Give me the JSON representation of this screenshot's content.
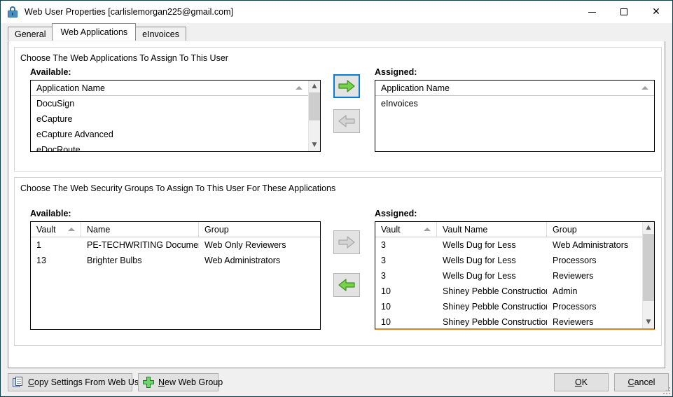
{
  "window": {
    "title": "Web User Properties [carlislemorgan225@gmail.com]",
    "icon": "lock-icon",
    "controls": {
      "minimize": "—",
      "maximize": "☐",
      "close": "✕"
    }
  },
  "tabs": [
    {
      "label": "General",
      "active": false
    },
    {
      "label": "Web Applications",
      "active": true
    },
    {
      "label": "eInvoices",
      "active": false
    }
  ],
  "applications_section": {
    "instruction": "Choose The Web Applications To Assign To This User",
    "available_label": "Available:",
    "assigned_label": "Assigned:",
    "available_list": {
      "column_header": "Application Name",
      "sort_indicator": "ascending",
      "items": [
        "DocuSign",
        "eCapture",
        "eCapture Advanced",
        "eDocRoute"
      ]
    },
    "assigned_list": {
      "column_header": "Application Name",
      "sort_indicator": "ascending",
      "items": [
        "eInvoices"
      ]
    },
    "move_right_button": {
      "name": "assign-application-button",
      "icon": "arrow-right-icon",
      "enabled": true,
      "focused": true
    },
    "move_left_button": {
      "name": "unassign-application-button",
      "icon": "arrow-left-icon",
      "enabled": false,
      "focused": false
    }
  },
  "security_section": {
    "instruction": "Choose The Web Security Groups To Assign To This User For These Applications",
    "available_label": "Available:",
    "assigned_label": "Assigned:",
    "available_grid": {
      "columns": [
        "Vault",
        "Name",
        "Group"
      ],
      "sorted_column": "Vault",
      "sort_indicator": "ascending",
      "rows": [
        {
          "vault": "1",
          "name": "PE-TECHWRITING Documents",
          "group": "Web Only Reviewers"
        },
        {
          "vault": "13",
          "name": "Brighter Bulbs",
          "group": "Web Administrators"
        }
      ]
    },
    "assigned_grid": {
      "columns": [
        "Vault",
        "Vault Name",
        "Group"
      ],
      "sorted_column": "Vault",
      "sort_indicator": "ascending",
      "accent_color": "#e08020",
      "rows": [
        {
          "vault": "3",
          "name": "Wells Dug for Less",
          "group": "Web Administrators"
        },
        {
          "vault": "3",
          "name": "Wells Dug for Less",
          "group": "Processors"
        },
        {
          "vault": "3",
          "name": "Wells Dug for Less",
          "group": "Reviewers"
        },
        {
          "vault": "10",
          "name": "Shiney Pebble Construction",
          "group": "Admin"
        },
        {
          "vault": "10",
          "name": "Shiney Pebble Construction",
          "group": "Processors"
        },
        {
          "vault": "10",
          "name": "Shiney Pebble Construction",
          "group": "Reviewers"
        }
      ]
    },
    "move_right_button": {
      "name": "assign-group-button",
      "icon": "arrow-right-icon",
      "enabled": false,
      "focused": false
    },
    "move_left_button": {
      "name": "unassign-group-button",
      "icon": "arrow-left-icon",
      "enabled": true,
      "focused": false
    }
  },
  "footer": {
    "copy_settings": {
      "label_pre": "",
      "accel": "C",
      "label_post": "opy Settings From Web User",
      "icon": "copy-document-icon"
    },
    "new_web_group": {
      "label_pre": "",
      "accel": "N",
      "label_post": "ew Web Group",
      "icon": "plus-icon"
    },
    "ok": {
      "accel": "O",
      "rest": "K"
    },
    "cancel": {
      "accel": "C",
      "rest": "ancel"
    }
  },
  "colors": {
    "accent_orange": "#e08020",
    "focus_blue": "#0a7ad4",
    "arrow_green": "#77d34a",
    "window_border": "#0e3a4a"
  }
}
